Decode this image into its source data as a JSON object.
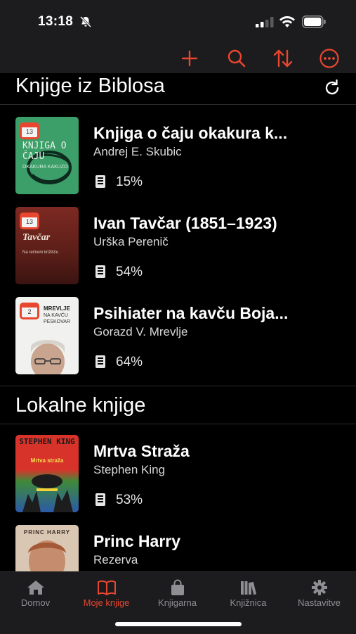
{
  "status": {
    "time": "13:18"
  },
  "colors": {
    "accent": "#e8462f",
    "background": "#000000",
    "bar": "#1c1c1e"
  },
  "toolbar": {
    "icons": [
      "plus-icon",
      "search-icon",
      "sort-icon",
      "more-icon"
    ]
  },
  "sections": [
    {
      "title": "Knjige iz Biblosa",
      "books": [
        {
          "title": "Knjiga o čaju okakura k...",
          "author": "Andrej E. Skubic",
          "progress": "15%",
          "days_left": "13",
          "cover_text": "KNJIGA O ČAJU",
          "cover_subtext": "OKAKURA KAKUZO"
        },
        {
          "title": "Ivan Tavčar (1851–1923)",
          "author": "Urška Perenič",
          "progress": "54%",
          "days_left": "13",
          "cover_text": "Tavčar",
          "cover_subtext": "Na rečnem križišču"
        },
        {
          "title": "Psihiater na kavču Boja...",
          "author": "Gorazd V. Mrevlje",
          "progress": "64%",
          "days_left": "2",
          "cover_text": "MREVLJE",
          "cover_subtext": "NA KAVČU PESKOVAR"
        }
      ]
    },
    {
      "title": "Lokalne knjige",
      "books": [
        {
          "title": "Mrtva Straža",
          "author": "Stephen King",
          "progress": "53%",
          "cover_text": "STEPHEN KING",
          "cover_subtext": "Mrtva straža"
        },
        {
          "title": "Princ Harry",
          "author": "Rezerva",
          "cover_text": "PRINC HARRY"
        }
      ]
    }
  ],
  "tabs": [
    {
      "label": "Domov",
      "icon": "home-icon",
      "active": false
    },
    {
      "label": "Moje knjige",
      "icon": "book-open-icon",
      "active": true
    },
    {
      "label": "Knjigarna",
      "icon": "shopping-bag-icon",
      "active": false
    },
    {
      "label": "Knjižnica",
      "icon": "library-icon",
      "active": false
    },
    {
      "label": "Nastavitve",
      "icon": "gear-icon",
      "active": false
    }
  ]
}
